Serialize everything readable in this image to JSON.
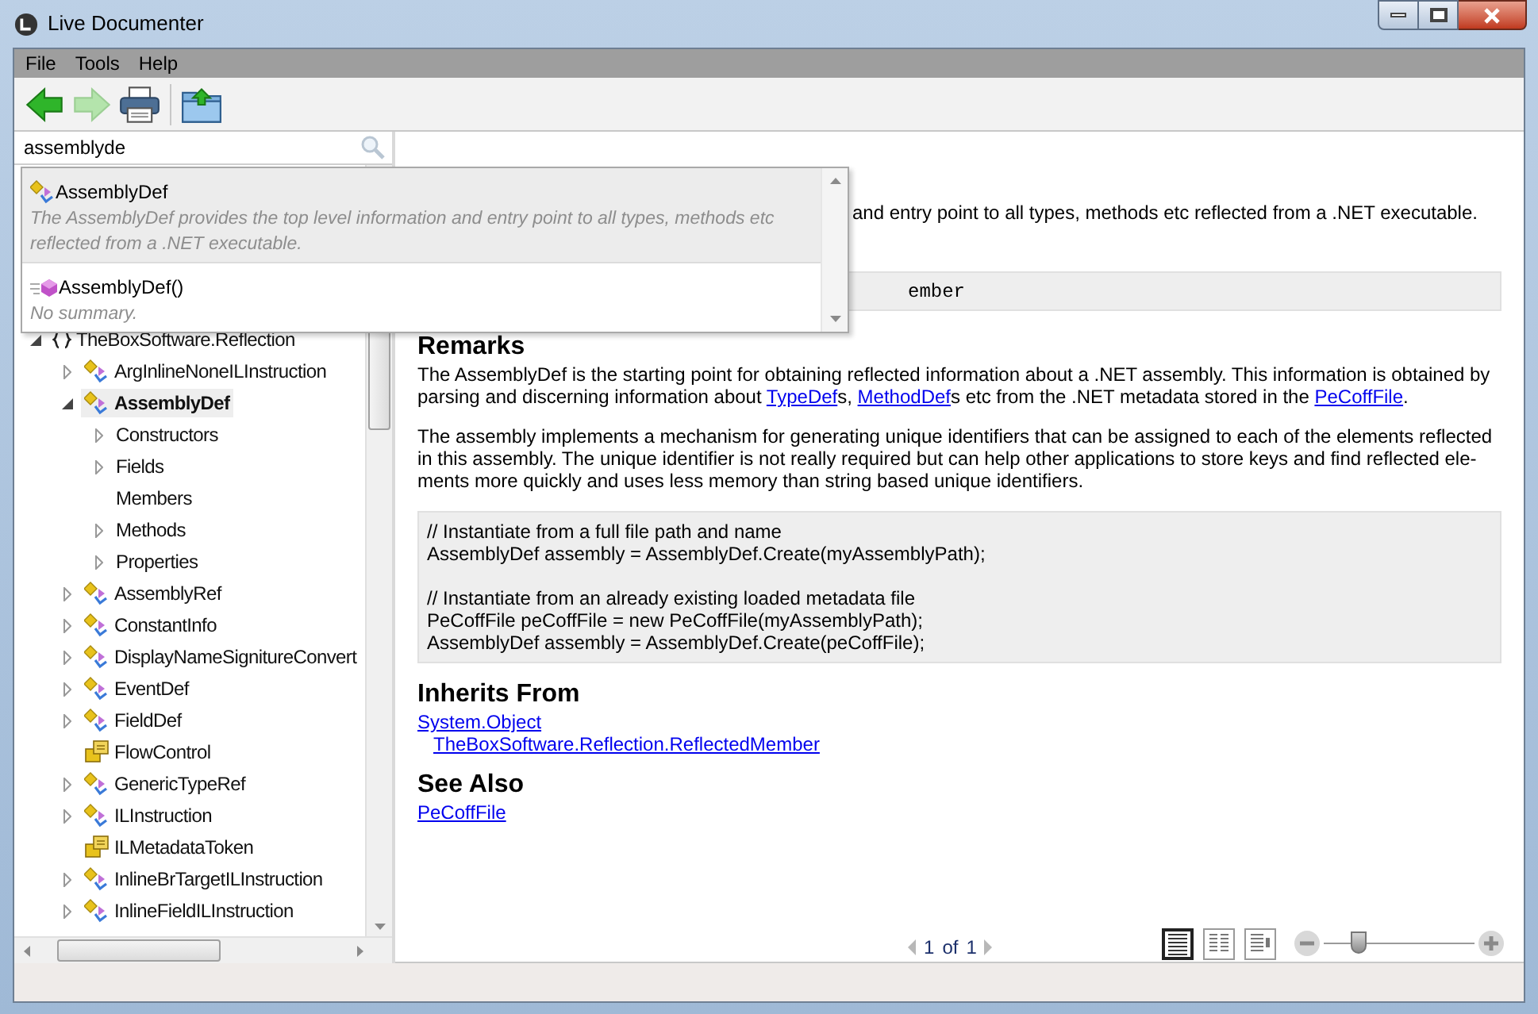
{
  "window": {
    "title": "Live Documenter"
  },
  "menu": [
    "File",
    "Tools",
    "Help"
  ],
  "toolbar": [
    {
      "kind": "back",
      "disabled": false
    },
    {
      "kind": "forward",
      "disabled": true
    },
    {
      "kind": "print",
      "disabled": false
    },
    {
      "kind": "open",
      "disabled": false
    }
  ],
  "search": {
    "value": "assemblyde"
  },
  "suggestions": [
    {
      "label": "AssemblyDef",
      "kind": "class",
      "summary": "The AssemblyDef provides the top level information and entry point to all types, methods etc reflected from a .NET executable.",
      "selected": true
    },
    {
      "label": "AssemblyDef()",
      "kind": "method",
      "summary": "No summary.",
      "selected": false
    }
  ],
  "tree": [
    {
      "label": "TheBoxSoftware.Reflection",
      "kind": "namespace",
      "expanded": true,
      "selected": false,
      "children": [
        {
          "label": "ArgInlineNoneILInstruction",
          "kind": "class",
          "expanded": false,
          "selected": false
        },
        {
          "label": "AssemblyDef",
          "kind": "class",
          "expanded": true,
          "selected": true,
          "children": [
            {
              "label": "Constructors",
              "kind": "group",
              "expanded": false,
              "selected": false
            },
            {
              "label": "Fields",
              "kind": "group",
              "expanded": false,
              "selected": false
            },
            {
              "label": "Members",
              "kind": "group",
              "selected": false
            },
            {
              "label": "Methods",
              "kind": "group",
              "expanded": false,
              "selected": false
            },
            {
              "label": "Properties",
              "kind": "group",
              "expanded": false,
              "selected": false
            }
          ]
        },
        {
          "label": "AssemblyRef",
          "kind": "class",
          "expanded": false,
          "selected": false
        },
        {
          "label": "ConstantInfo",
          "kind": "class",
          "expanded": false,
          "selected": false
        },
        {
          "label": "DisplayNameSignitureConvert",
          "kind": "class",
          "expanded": false,
          "selected": false
        },
        {
          "label": "EventDef",
          "kind": "class",
          "expanded": false,
          "selected": false
        },
        {
          "label": "FieldDef",
          "kind": "class",
          "expanded": false,
          "selected": false
        },
        {
          "label": "FlowControl",
          "kind": "enum",
          "selected": false
        },
        {
          "label": "GenericTypeRef",
          "kind": "class",
          "expanded": false,
          "selected": false
        },
        {
          "label": "ILInstruction",
          "kind": "class",
          "expanded": false,
          "selected": false
        },
        {
          "label": "ILMetadataToken",
          "kind": "enum",
          "selected": false
        },
        {
          "label": "InlineBrTargetILInstruction",
          "kind": "class",
          "expanded": false,
          "selected": false
        },
        {
          "label": "InlineFieldILInstruction",
          "kind": "class",
          "expanded": false,
          "selected": false
        }
      ]
    }
  ],
  "document": {
    "summary": "and entry point to all types, methods etc reflected from a .NET executable.",
    "syntax": "ember",
    "remarks": {
      "heading": "Remarks",
      "paragraphs": [
        [
          {
            "text": "The AssemblyDef is the starting point for obtaining reflected information about a .NET assembly. This information is obtained by parsing and discerning information about "
          },
          {
            "text": "TypeDef",
            "link": true
          },
          {
            "text": "s, "
          },
          {
            "text": "MethodDef",
            "link": true
          },
          {
            "text": "s etc from the .NET metadata stored in the "
          },
          {
            "text": "PeCoffFile",
            "link": true
          },
          {
            "text": "."
          }
        ],
        [
          {
            "text": "The assembly implements a mechanism for generating unique identifiers that can be assigned to each of the elements reflected in this assembly. The unique identifier is not really required but can help other applications to store keys and find reflected ele-ments more quickly and uses less memory than string based unique identifiers."
          }
        ]
      ]
    },
    "example": [
      [
        "// Instantiate from a full file path and name",
        "AssemblyDef assembly = AssemblyDef.Create(myAssemblyPath);"
      ],
      [
        "// Instantiate from an already existing loaded metadata file",
        "PeCoffFile peCoffFile = new PeCoffFile(myAssemblyPath);",
        "AssemblyDef assembly = AssemblyDef.Create(peCoffFile);"
      ]
    ],
    "inherits": {
      "heading": "Inherits From",
      "links": [
        "System.Object",
        "TheBoxSoftware.Reflection.ReflectedMember"
      ]
    },
    "see_also": {
      "heading": "See Also",
      "links": [
        "PeCoffFile"
      ]
    }
  },
  "pager": {
    "page": "1",
    "of": "of",
    "total": "1"
  },
  "views": [
    {
      "kind": "single",
      "selected": true
    },
    {
      "kind": "columns",
      "selected": false
    },
    {
      "kind": "sidebar",
      "selected": false
    }
  ],
  "zoom": {
    "level": 0.2
  }
}
